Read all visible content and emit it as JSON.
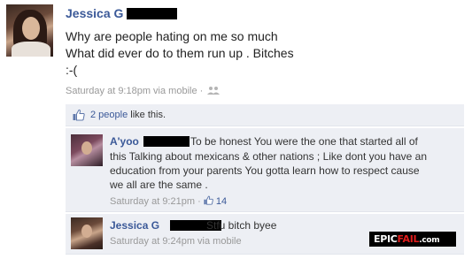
{
  "post": {
    "author": "Jessica G",
    "lines": [
      "Why are people hating on me so much",
      "What did ever do to them run up . Bitches",
      ":-("
    ],
    "time": "Saturday at 9:18pm via mobile",
    "separator": " · "
  },
  "likes": {
    "people": "2 people",
    "suffix": " like this."
  },
  "comments": [
    {
      "author": "A'yoo",
      "first_line": "To be honest You were the one that started all of",
      "lines": [
        "this Talking about mexicans & other nations ; Like dont you have an",
        "education from your parents You gotta learn how to respect cause",
        "we all are the same ."
      ],
      "time": "Saturday at 9:21pm",
      "separator": " · ",
      "like_count": "14"
    },
    {
      "author": "Jessica G",
      "text": "Stfu bitch byee",
      "time": "Saturday at 9:24pm via mobile"
    }
  ],
  "watermark": {
    "epic": "EPIC",
    "fail": "FAIL",
    "domain": ".com"
  },
  "colors": {
    "link": "#3b5998",
    "comment_bg": "#edeff4",
    "meta": "#999999",
    "fail_red": "#e01b1b"
  }
}
